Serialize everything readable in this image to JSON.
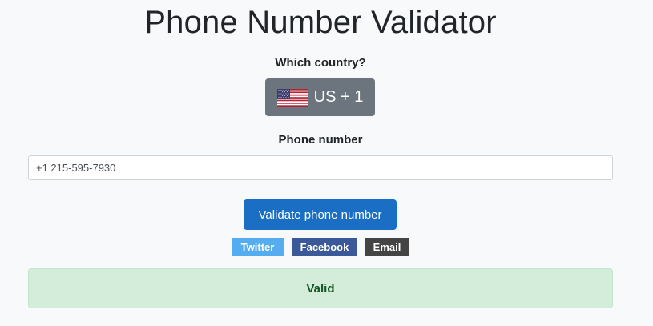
{
  "header": {
    "title": "Phone Number Validator"
  },
  "country": {
    "label": "Which country?",
    "flag_icon": "us-flag-icon",
    "selected": "US + 1"
  },
  "phone": {
    "label": "Phone number",
    "value": "+1 215-595-7930"
  },
  "actions": {
    "validate_label": "Validate phone number"
  },
  "share": {
    "twitter": "Twitter",
    "facebook": "Facebook",
    "email": "Email"
  },
  "result": {
    "text": "Valid",
    "status_color": "#d4edda"
  }
}
